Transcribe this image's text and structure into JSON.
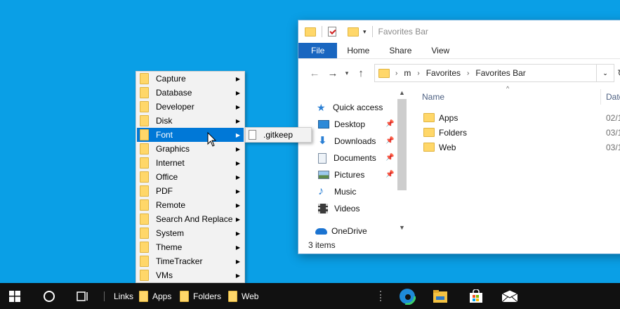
{
  "explorer": {
    "title": "Favorites Bar",
    "ribbon_tabs": [
      "File",
      "Home",
      "Share",
      "View"
    ],
    "breadcrumb": [
      "m",
      "Favorites",
      "Favorites Bar"
    ],
    "nav_items": [
      {
        "label": "Quick access",
        "icon": "star-icon",
        "pinned": false
      },
      {
        "label": "Desktop",
        "icon": "desktop-icon",
        "pinned": true
      },
      {
        "label": "Downloads",
        "icon": "download-icon",
        "pinned": true
      },
      {
        "label": "Documents",
        "icon": "document-icon",
        "pinned": true
      },
      {
        "label": "Pictures",
        "icon": "picture-icon",
        "pinned": true
      },
      {
        "label": "Music",
        "icon": "music-icon",
        "pinned": false
      },
      {
        "label": "Videos",
        "icon": "video-icon",
        "pinned": false
      },
      {
        "label": "OneDrive",
        "icon": "cloud-icon",
        "pinned": false
      }
    ],
    "columns": {
      "name": "Name",
      "date": "Date"
    },
    "files": [
      {
        "name": "Apps",
        "date": "02/1"
      },
      {
        "name": "Folders",
        "date": "03/1"
      },
      {
        "name": "Web",
        "date": "03/1"
      }
    ],
    "status": "3 items"
  },
  "menu": {
    "items": [
      "Capture",
      "Database",
      "Developer",
      "Disk",
      "Font",
      "Graphics",
      "Internet",
      "Office",
      "PDF",
      "Remote",
      "Search And Replace",
      "System",
      "Theme",
      "TimeTracker",
      "VMs"
    ],
    "highlighted": "Font",
    "submenu_item": ".gitkeep"
  },
  "taskbar": {
    "toolbar_label": "Links",
    "links": [
      "Apps",
      "Folders",
      "Web"
    ]
  },
  "colors": {
    "desktop": "#0a9fe6",
    "accent": "#0078d7",
    "file_tab": "#1966c0",
    "folder": "#ffd769"
  }
}
